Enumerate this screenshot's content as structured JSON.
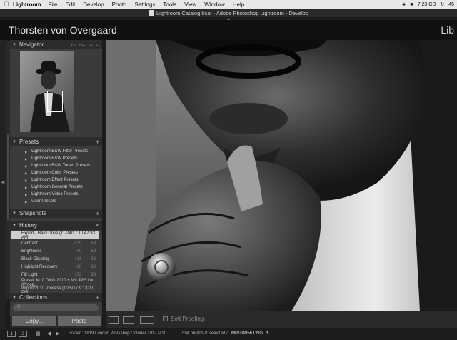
{
  "menubar": {
    "app": "Lightroom",
    "items": [
      "File",
      "Edit",
      "Develop",
      "Photo",
      "Settings",
      "Tools",
      "View",
      "Window",
      "Help"
    ],
    "storage": "7.23 GB",
    "time": "45"
  },
  "window": {
    "title": "Lightroom Catalog.lrcat - Adobe Photoshop Lightroom - Develop"
  },
  "identity": {
    "name": "Thorsten von Overgaard",
    "module": "Lib"
  },
  "navigator": {
    "title": "Navigator",
    "zoom": [
      "FIT",
      "FILL",
      "1:1",
      "4:1"
    ]
  },
  "presets": {
    "title": "Presets",
    "items": [
      "Lightroom B&W Filter Presets",
      "Lightroom B&W Presets",
      "Lightroom B&W Toned Presets",
      "Lightroom Color Presets",
      "Lightroom Effect Presets",
      "Lightroom General Presets",
      "Lightroom Video Presets",
      "User Presets"
    ]
  },
  "snapshots": {
    "title": "Snapshots"
  },
  "history": {
    "title": "History",
    "items": [
      {
        "label": "Export - Hard Drive (11/24/17 10:47:33 AM)",
        "a": "",
        "b": ""
      },
      {
        "label": "Contrast",
        "a": "+25",
        "b": "50"
      },
      {
        "label": "Brightness",
        "a": "+9",
        "b": "59"
      },
      {
        "label": "Black Clipping",
        "a": "+11",
        "b": "16"
      },
      {
        "label": "Highlight Recovery",
        "a": "+18",
        "b": "18"
      },
      {
        "label": "Fill Light",
        "a": "+33",
        "b": "33"
      },
      {
        "label": "Preset: M10 DNG 2010 + M9 JPG.lrw (Proce...",
        "a": "",
        "b": ""
      },
      {
        "label": "Import/2010 Process (10/5/17 9:13:27 PM)",
        "a": "",
        "b": ""
      }
    ]
  },
  "collections": {
    "title": "Collections",
    "search_placeholder": "Q•"
  },
  "buttons": {
    "copy": "Copy...",
    "paste": "Paste"
  },
  "toolbar": {
    "soft_proofing": "Soft Proofing"
  },
  "filmstrip": {
    "pages": [
      "1",
      "2"
    ],
    "folder": "Folder : 1819 London Workshop October 2017 M10",
    "count": "594 photos /1 selected /",
    "file": "MP104956.DNG"
  }
}
